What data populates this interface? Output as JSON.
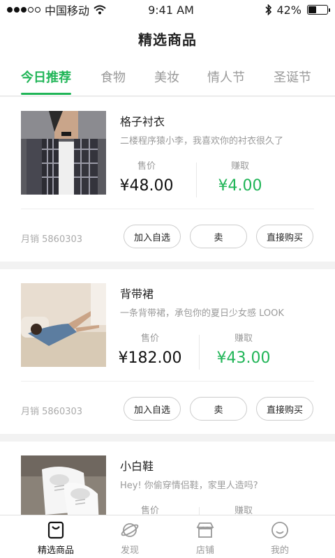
{
  "status": {
    "carrier": "中国移动",
    "time": "9:41 AM",
    "battery": "42%",
    "battery_level": 0.42
  },
  "header": {
    "title": "精选商品"
  },
  "tabs": [
    {
      "label": "今日推荐",
      "active": true
    },
    {
      "label": "食物"
    },
    {
      "label": "美妆"
    },
    {
      "label": "情人节"
    },
    {
      "label": "圣诞节"
    }
  ],
  "products": [
    {
      "title": "格子衬衣",
      "desc": "二楼程序猿小李，我喜欢你的衬衣很久了",
      "price_label": "售价",
      "price": "¥48.00",
      "earn_label": "赚取",
      "earn": "¥4.00",
      "sales": "月销 5860303",
      "buttons": [
        "加入自选",
        "卖",
        "直接购买"
      ]
    },
    {
      "title": "背带裙",
      "desc": "一条背带裙，承包你的夏日少女感 LOOK",
      "price_label": "售价",
      "price": "¥182.00",
      "earn_label": "赚取",
      "earn": "¥43.00",
      "sales": "月销 5860303",
      "buttons": [
        "加入自选",
        "卖",
        "直接购买"
      ]
    },
    {
      "title": "小白鞋",
      "desc": "Hey! 你偷穿情侣鞋，家里人造吗?",
      "price_label": "售价",
      "earn_label": "赚取"
    }
  ],
  "tabbar": [
    {
      "label": "精选商品",
      "icon": "shopping-bag-icon",
      "active": true
    },
    {
      "label": "发现",
      "icon": "planet-icon"
    },
    {
      "label": "店铺",
      "icon": "store-icon"
    },
    {
      "label": "我的",
      "icon": "smiley-icon"
    }
  ],
  "colors": {
    "accent": "#20b557",
    "text": "#222222",
    "muted": "#999999",
    "background": "#f2f2f2"
  }
}
